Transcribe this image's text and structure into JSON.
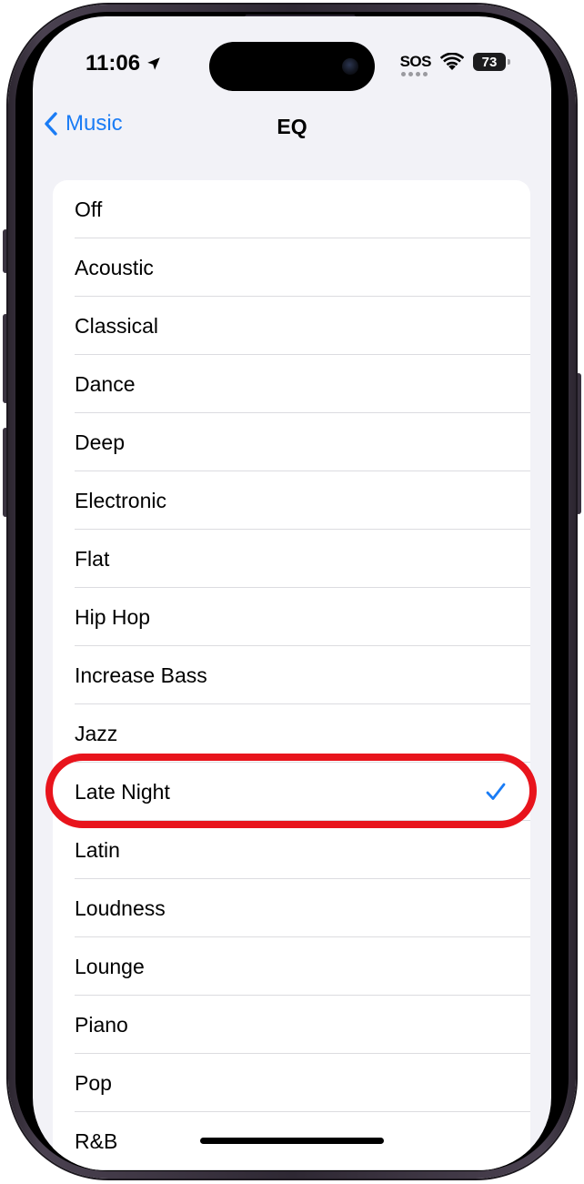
{
  "status_bar": {
    "time": "11:06",
    "sos": "SOS",
    "battery": "73"
  },
  "nav": {
    "back_label": "Music",
    "title": "EQ"
  },
  "eq_list": {
    "items": [
      {
        "label": "Off",
        "selected": false
      },
      {
        "label": "Acoustic",
        "selected": false
      },
      {
        "label": "Classical",
        "selected": false
      },
      {
        "label": "Dance",
        "selected": false
      },
      {
        "label": "Deep",
        "selected": false
      },
      {
        "label": "Electronic",
        "selected": false
      },
      {
        "label": "Flat",
        "selected": false
      },
      {
        "label": "Hip Hop",
        "selected": false
      },
      {
        "label": "Increase Bass",
        "selected": false
      },
      {
        "label": "Jazz",
        "selected": false
      },
      {
        "label": "Late Night",
        "selected": true
      },
      {
        "label": "Latin",
        "selected": false
      },
      {
        "label": "Loudness",
        "selected": false
      },
      {
        "label": "Lounge",
        "selected": false
      },
      {
        "label": "Piano",
        "selected": false
      },
      {
        "label": "Pop",
        "selected": false
      },
      {
        "label": "R&B",
        "selected": false
      }
    ]
  },
  "colors": {
    "accent": "#1a7cf5",
    "annotation": "#e8141c",
    "background": "#f2f2f7"
  },
  "icons": {
    "back": "chevron-left-icon",
    "location": "location-arrow-icon",
    "wifi": "wifi-icon",
    "battery": "battery-icon",
    "selected": "checkmark-icon"
  }
}
